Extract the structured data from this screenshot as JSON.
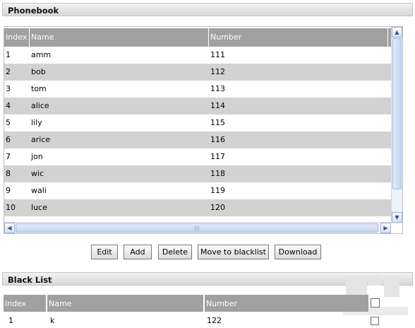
{
  "phonebook": {
    "title": "Phonebook",
    "columns": [
      "Index",
      "Name",
      "Number"
    ],
    "rows": [
      {
        "index": "1",
        "name": "amm",
        "number": "111",
        "checked": false
      },
      {
        "index": "2",
        "name": "bob",
        "number": "112",
        "checked": false
      },
      {
        "index": "3",
        "name": "tom",
        "number": "113",
        "checked": true
      },
      {
        "index": "4",
        "name": "alice",
        "number": "114",
        "checked": false
      },
      {
        "index": "5",
        "name": "lily",
        "number": "115",
        "checked": false
      },
      {
        "index": "6",
        "name": "arice",
        "number": "116",
        "checked": false
      },
      {
        "index": "7",
        "name": "jon",
        "number": "117",
        "checked": false
      },
      {
        "index": "8",
        "name": "wic",
        "number": "118",
        "checked": false
      },
      {
        "index": "9",
        "name": "wali",
        "number": "119",
        "checked": false
      },
      {
        "index": "10",
        "name": "luce",
        "number": "120",
        "checked": false
      }
    ]
  },
  "buttons": {
    "edit": "Edit",
    "add": "Add",
    "delete": "Delete",
    "move_to_blacklist": "Move to blacklist",
    "download": "Download"
  },
  "blacklist": {
    "title": "Black List",
    "columns": [
      "Index",
      "Name",
      "Number"
    ],
    "rows": [
      {
        "index": "1",
        "name": "k",
        "number": "122",
        "checked": false
      }
    ]
  },
  "icons": {
    "scroll_up": "chevron-up-icon",
    "scroll_down": "chevron-down-icon",
    "scroll_left": "chevron-left-icon",
    "scroll_right": "chevron-right-icon",
    "checkbox": "checkbox-icon",
    "watermark": "watermark-logo"
  },
  "colors": {
    "table_header": "#a0a0a0",
    "alt_row": "#d2d2d2",
    "scrollbar": "#c7d5f1"
  }
}
